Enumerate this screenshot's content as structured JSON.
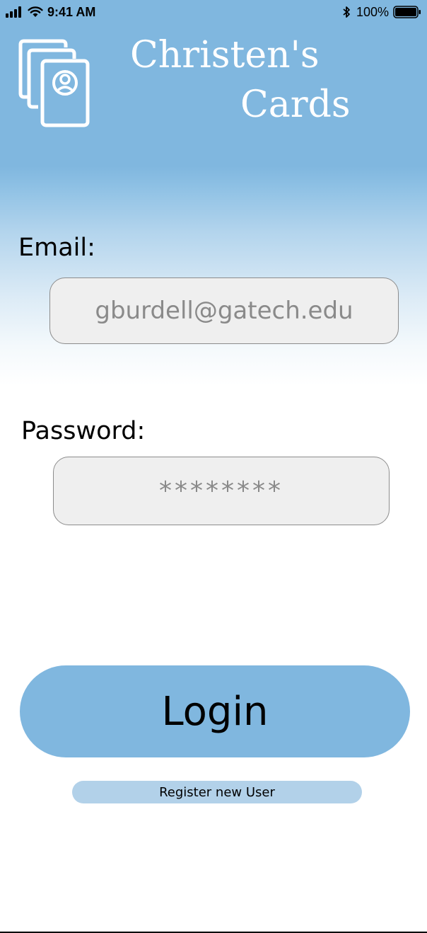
{
  "status_bar": {
    "time": "9:41 AM",
    "battery_percent": "100%",
    "icons": [
      "signal-bars-icon",
      "wifi-icon",
      "bluetooth-icon",
      "battery-icon"
    ]
  },
  "app": {
    "logo_icon": "cards-stack-icon",
    "title_line1": "Christen's",
    "title_line2": "Cards"
  },
  "form": {
    "email_label": "Email:",
    "email_value": "gburdell@gatech.edu",
    "password_label": "Password:",
    "password_value": "********"
  },
  "actions": {
    "login_label": "Login",
    "register_label": "Register new User"
  },
  "colors": {
    "accent": "#80b7df",
    "register_button": "#b2d1e9",
    "field_background": "#efefef"
  }
}
